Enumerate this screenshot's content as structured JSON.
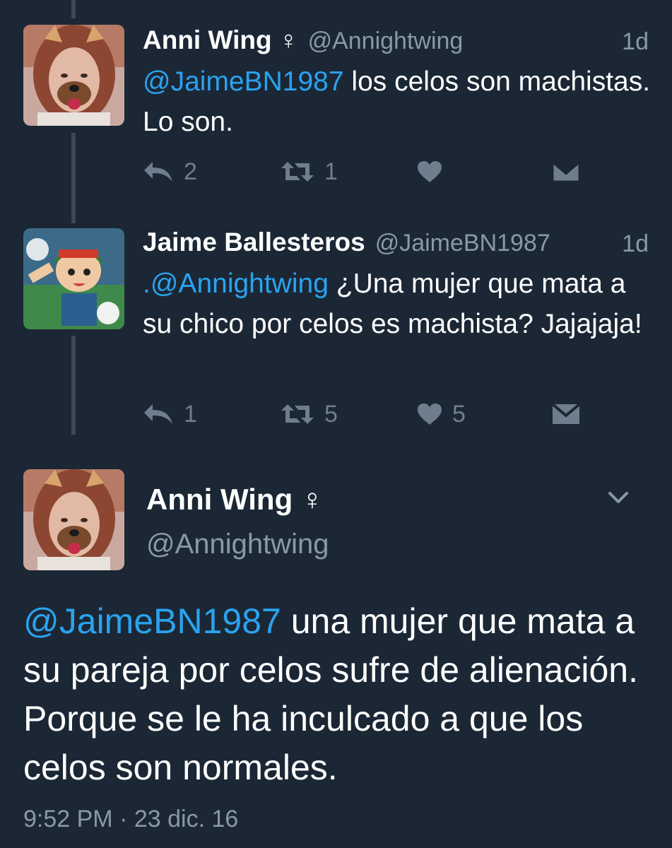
{
  "tweets": [
    {
      "name": "Anni Wing",
      "gender_symbol": "♀",
      "handle": "@Annightwing",
      "time": "1d",
      "mention": "@JaimeBN1987",
      "text": " los celos son machistas. Lo son.",
      "reply_count": "2",
      "retweet_count": "1",
      "like_count": ""
    },
    {
      "name": "Jaime Ballesteros",
      "handle": "@JaimeBN1987",
      "time": "1d",
      "mention": ".@Annightwing",
      "text": " ¿Una mujer que mata a su chico por celos es machista? Jajajaja!",
      "reply_count": "1",
      "retweet_count": "5",
      "like_count": "5"
    }
  ],
  "main_tweet": {
    "name": "Anni Wing",
    "gender_symbol": "♀",
    "handle": "@Annightwing",
    "mention": "@JaimeBN1987",
    "text": " una mujer que mata a su pareja por celos sufre de alienación. Porque se le ha inculcado a que los celos son normales.",
    "timestamp": "9:52 PM · 23 dic. 16"
  },
  "colors": {
    "background": "#1b2735",
    "mention": "#2aa3ef",
    "secondary_text": "#8899a6",
    "action_icon": "#6f7e8c",
    "thread_line": "#3b4957"
  },
  "icons": {
    "reply": "reply-icon",
    "retweet": "retweet-icon",
    "like": "heart-icon",
    "dm": "envelope-icon",
    "more": "chevron-down-icon"
  }
}
